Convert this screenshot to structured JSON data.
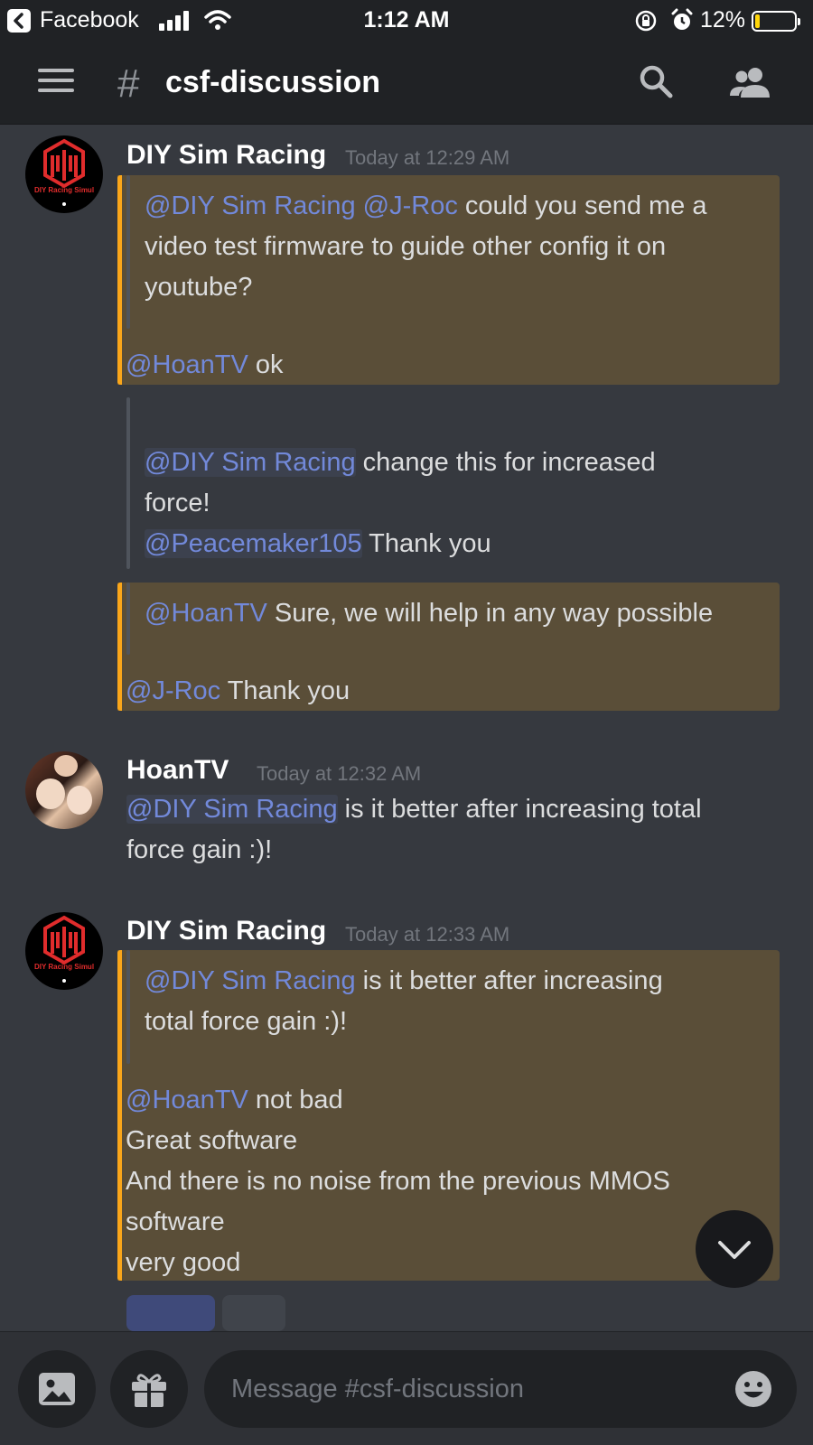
{
  "status_bar": {
    "back_app": "Facebook",
    "time": "1:12 AM",
    "battery_percent": "12%",
    "battery_level": 0.12,
    "battery_color": "#ffd60a"
  },
  "header": {
    "channel_hash": "#",
    "channel_name": "csf-discussion",
    "icons": [
      "menu-icon",
      "search-icon",
      "members-icon"
    ]
  },
  "messages": [
    {
      "author": "DIY Sim Racing",
      "timestamp": "Today at 12:29 AM",
      "avatar_text": "DIY Racing Simul",
      "quote1": {
        "l1_mention1": "@DIY Sim Racing",
        "l1_mention2": "@J-Roc",
        "l1_text": " could you send me a",
        "l2": "video test firmware  to guide other config it on",
        "l3": "youtube?",
        "reply_mention": "@HoanTV",
        "reply_text": " ok"
      },
      "quote2": {
        "l1_mention": "@DIY Sim Racing",
        "l1_text": " change this for increased",
        "l2": "force!",
        "l3_mention": "@Peacemaker105",
        "l3_text": " Thank you"
      },
      "quote3": {
        "l1_mention": "@HoanTV",
        "l1_text": " Sure, we will help in any way possible",
        "reply_mention": "@J-Roc",
        "reply_text": " Thank you"
      }
    },
    {
      "author": "HoanTV",
      "timestamp": "Today at 12:32 AM",
      "mention": "@DIY Sim Racing",
      "l1_text": " is it better after increasing total",
      "l2": "force gain :)!"
    },
    {
      "author": "DIY Sim Racing",
      "timestamp": "Today at 12:33 AM",
      "avatar_text": "DIY Racing Simul",
      "quote": {
        "l1_mention": "@DIY Sim Racing",
        "l1_text": " is it better after increasing",
        "l2": "total force gain :)!",
        "reply_mention": "@HoanTV",
        "reply_text": " not bad",
        "r2": "Great software",
        "r3": "And there is no noise from the previous MMOS",
        "r4": "software",
        "r5": "very good"
      }
    }
  ],
  "composer": {
    "placeholder": "Message #csf-discussion",
    "icons": [
      "image-icon",
      "gift-icon",
      "emoji-icon"
    ]
  },
  "colors": {
    "background": "#36393f",
    "header": "#202225",
    "mention": "#7289da",
    "quote_bar": "#faa61a",
    "quote_bg": "#5a4e38"
  }
}
